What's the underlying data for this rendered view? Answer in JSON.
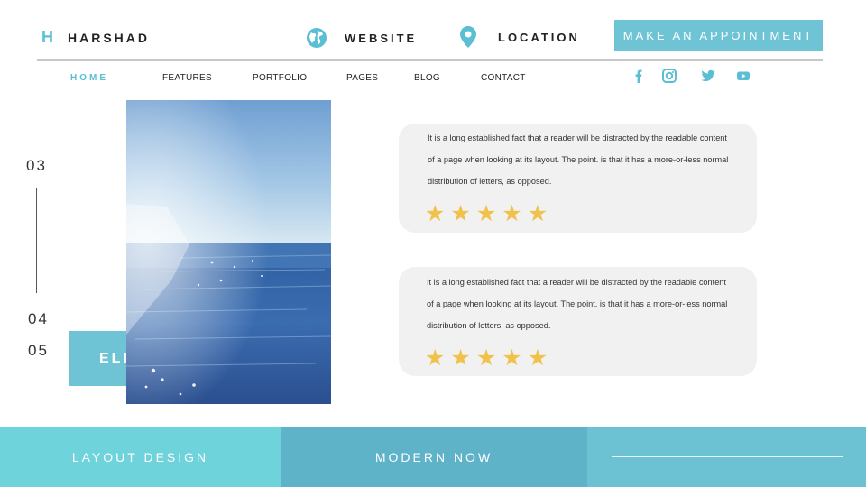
{
  "header": {
    "brand_mark": "H",
    "brand_name": "HARSHAD",
    "website_label": "WEBSITE",
    "location_label": "LOCATION",
    "appointment_button": "MAKE AN APPOINTMENT",
    "icons": [
      "globe-icon",
      "location-pin-icon"
    ]
  },
  "nav": {
    "items": [
      {
        "label": "HOME",
        "active": true
      },
      {
        "label": "FEATURES"
      },
      {
        "label": "PORTFOLIO"
      },
      {
        "label": "PAGES"
      },
      {
        "label": "BLOG"
      },
      {
        "label": "CONTACT"
      }
    ],
    "social_icons": [
      "facebook-icon",
      "instagram-icon",
      "twitter-icon",
      "youtube-icon"
    ]
  },
  "side": {
    "numbers": [
      "03",
      "04",
      "05"
    ],
    "box_text": "ELI"
  },
  "testimonials": [
    {
      "text": "It is a long established fact that a reader will be distracted by the readable content of a page when looking at its layout. The point. is that it has a more-or-less normal distribution of letters, as opposed.",
      "rating": 5
    },
    {
      "text": "It is a long established fact that a reader will be distracted by the readable content of a page when looking at its layout. The point. is that it has a more-or-less normal distribution of letters, as opposed.",
      "rating": 5
    }
  ],
  "footer": {
    "segments": [
      "LAYOUT DESIGN",
      "MODERN NOW"
    ]
  },
  "colors": {
    "accent": "#5bbfd3",
    "button": "#6ec4d4",
    "star": "#f1c24b",
    "card_bg": "#f1f1f1",
    "footer_1": "#6fd3dc",
    "footer_2": "#5eb3c8",
    "footer_3": "#6cc2d2"
  }
}
